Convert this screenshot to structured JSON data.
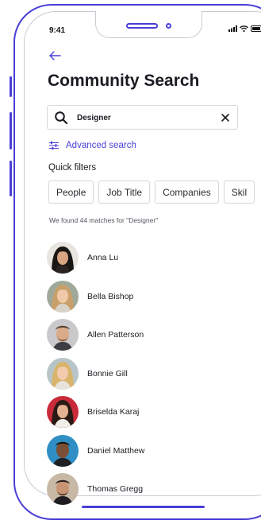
{
  "status_bar": {
    "time": "9:41",
    "icons": [
      "signal-icon",
      "wifi-icon",
      "battery-icon"
    ]
  },
  "nav": {
    "back_icon": "arrow-left-icon"
  },
  "page": {
    "title": "Community Search"
  },
  "search": {
    "value": "Designer",
    "search_icon": "magnifier-icon",
    "clear_icon": "close-icon"
  },
  "advanced_search": {
    "label": "Advanced search",
    "icon": "sliders-icon"
  },
  "quick_filters": {
    "title": "Quick filters",
    "chips": [
      "People",
      "Job Title",
      "Companies",
      "Skil"
    ]
  },
  "results": {
    "summary": "We found 44 matches for \"Designer\"",
    "people": [
      {
        "name": "Anna Lu"
      },
      {
        "name": "Bella Bishop"
      },
      {
        "name": "Allen Patterson"
      },
      {
        "name": "Bonnie Gill"
      },
      {
        "name": "Briselda Karaj"
      },
      {
        "name": "Daniel Matthew"
      },
      {
        "name": "Thomas Gregg"
      }
    ]
  },
  "colors": {
    "accent": "#4a3fd8",
    "text": "#1b1b22",
    "border": "#d6d6dc"
  }
}
